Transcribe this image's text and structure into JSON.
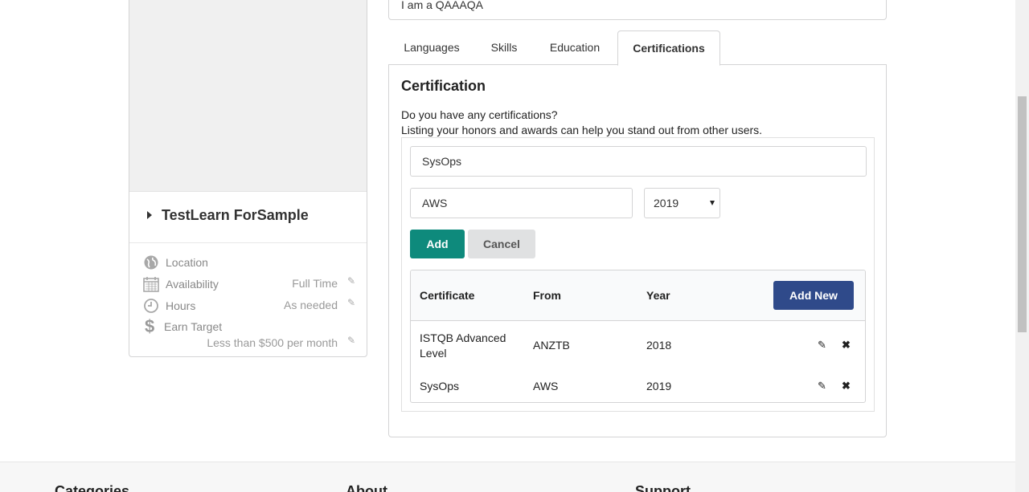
{
  "profile": {
    "name": "TestLearn ForSample",
    "location_label": "Location",
    "availability_label": "Availability",
    "availability_value": "Full Time",
    "hours_label": "Hours",
    "hours_value": "As needed",
    "earn_label": "Earn Target",
    "earn_value": "Less than $500 per month"
  },
  "about": {
    "text": "I am a QAAAQA"
  },
  "tabs": [
    {
      "label": "Languages"
    },
    {
      "label": "Skills"
    },
    {
      "label": "Education"
    },
    {
      "label": "Certifications"
    }
  ],
  "certification": {
    "title": "Certification",
    "question": "Do you have any certifications?",
    "hint": "Listing your honors and awards can help you stand out from other users.",
    "cert_input": "SysOps",
    "from_input": "AWS",
    "year_select": "2019",
    "add_label": "Add",
    "cancel_label": "Cancel",
    "add_new_label": "Add New",
    "columns": [
      "Certificate",
      "From",
      "Year"
    ],
    "rows": [
      {
        "certificate": "ISTQB Advanced Level",
        "from": "ANZTB",
        "year": "2018"
      },
      {
        "certificate": "SysOps",
        "from": "AWS",
        "year": "2019"
      }
    ]
  },
  "footer": {
    "col1": "Categories",
    "col2": "About",
    "col3": "Support"
  },
  "colors": {
    "add_button": "#0e8a7c",
    "add_new_button": "#2f4a8a"
  }
}
